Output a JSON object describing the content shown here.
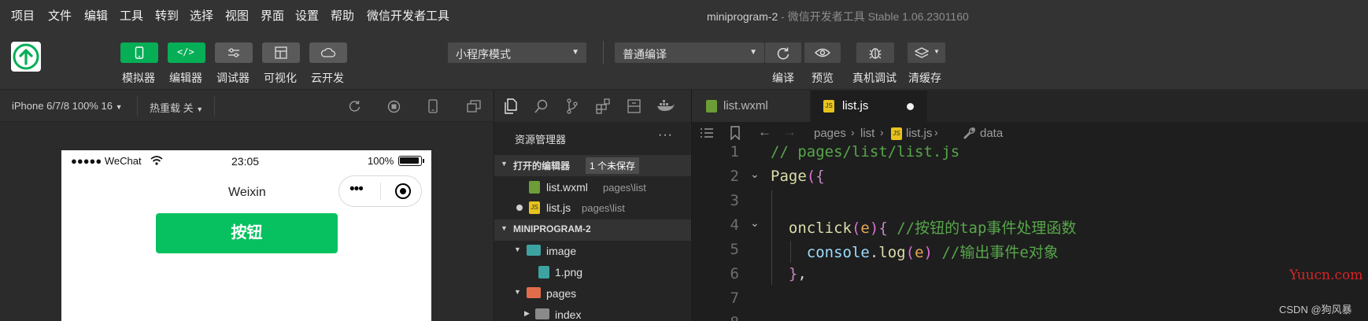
{
  "menu": [
    "项目",
    "文件",
    "编辑",
    "工具",
    "转到",
    "选择",
    "视图",
    "界面",
    "设置",
    "帮助",
    "微信开发者工具"
  ],
  "window": {
    "title": "miniprogram-2",
    "subtitle": " - 微信开发者工具 Stable 1.06.2301160"
  },
  "toolbar": {
    "buttons": [
      {
        "label": "模拟器",
        "icon": "phone-icon",
        "active": true
      },
      {
        "label": "编辑器",
        "icon": "code-icon",
        "active": true
      },
      {
        "label": "调试器",
        "icon": "sliders-icon",
        "active": false
      },
      {
        "label": "可视化",
        "icon": "layout-icon",
        "active": false
      },
      {
        "label": "云开发",
        "icon": "cloud-icon",
        "active": false
      }
    ],
    "mode_select": "小程序模式",
    "compile_select": "普通编译",
    "actions": [
      {
        "label": "编译",
        "icon": "refresh-icon"
      },
      {
        "label": "预览",
        "icon": "eye-icon"
      },
      {
        "label": "真机调试",
        "icon": "bug-icon"
      },
      {
        "label": "清缓存",
        "icon": "layers-icon"
      }
    ]
  },
  "simulator": {
    "device": "iPhone 6/7/8 100% 16",
    "hotreload": "热重载 关",
    "status": {
      "carrier": "●●●●● WeChat",
      "time": "23:05",
      "battery": "100%"
    },
    "nav_title": "Weixin",
    "capsule_dots": "•••",
    "button_label": "按钮"
  },
  "explorer": {
    "title": "资源管理器",
    "more": "···",
    "open_editors": {
      "label": "打开的编辑器",
      "badge": "1 个未保存"
    },
    "open_files": [
      {
        "name": "list.wxml",
        "path": "pages\\list",
        "unsaved": false
      },
      {
        "name": "list.js",
        "path": "pages\\list",
        "unsaved": true
      }
    ],
    "project": "MINIPROGRAM-2",
    "tree": [
      {
        "name": "image",
        "kind": "folder",
        "open": true
      },
      {
        "name": "1.png",
        "kind": "image"
      },
      {
        "name": "pages",
        "kind": "folder",
        "open": true
      },
      {
        "name": "index",
        "kind": "folder",
        "open": false
      }
    ]
  },
  "editor": {
    "tabs": [
      {
        "name": "list.wxml",
        "active": false
      },
      {
        "name": "list.js",
        "active": true,
        "dirty": true
      }
    ],
    "breadcrumb": [
      "pages",
      "list",
      "list.js",
      "data"
    ],
    "lines": [
      {
        "n": "1",
        "text": "// pages/list/list.js"
      },
      {
        "n": "2",
        "text": "Page({"
      },
      {
        "n": "3",
        "text": ""
      },
      {
        "n": "4",
        "text": "  onclick(e){ //按钮的tap事件处理函数"
      },
      {
        "n": "5",
        "text": "    console.log(e) //输出事件e对象"
      },
      {
        "n": "6",
        "text": "  },"
      },
      {
        "n": "7",
        "text": ""
      },
      {
        "n": "8",
        "text": ""
      }
    ]
  },
  "watermarks": {
    "yuucn": "Yuucn.com",
    "csdn": "CSDN @狗风暴"
  },
  "colors": {
    "accent": "#06ae56",
    "comment": "#57a64a",
    "keyword": "#dcdcaa",
    "bg": "#1e1e1e"
  }
}
